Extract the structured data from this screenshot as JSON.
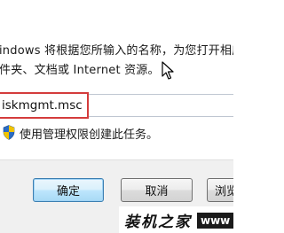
{
  "dialog": {
    "description_line1": "indows 将根据您所输入的名称，为您打开相应的",
    "description_line2": "件夹、文档或 Internet 资源。",
    "input": {
      "value": "iskmgmt.msc",
      "placeholder": ""
    },
    "admin_note": "使用管理权限创建此任务。",
    "buttons": {
      "ok": "确定",
      "cancel": "取消",
      "browse": "浏览"
    }
  },
  "watermark": {
    "text": "装机之家",
    "bar_text": "www"
  },
  "colors": {
    "highlight_border": "#d43c3c",
    "ok_button_border": "#3c7fb1",
    "shield_blue": "#2b6cc4",
    "shield_yellow": "#f2c400"
  },
  "icons": {
    "cursor": "mouse-pointer-icon",
    "shield": "uac-shield-icon"
  }
}
